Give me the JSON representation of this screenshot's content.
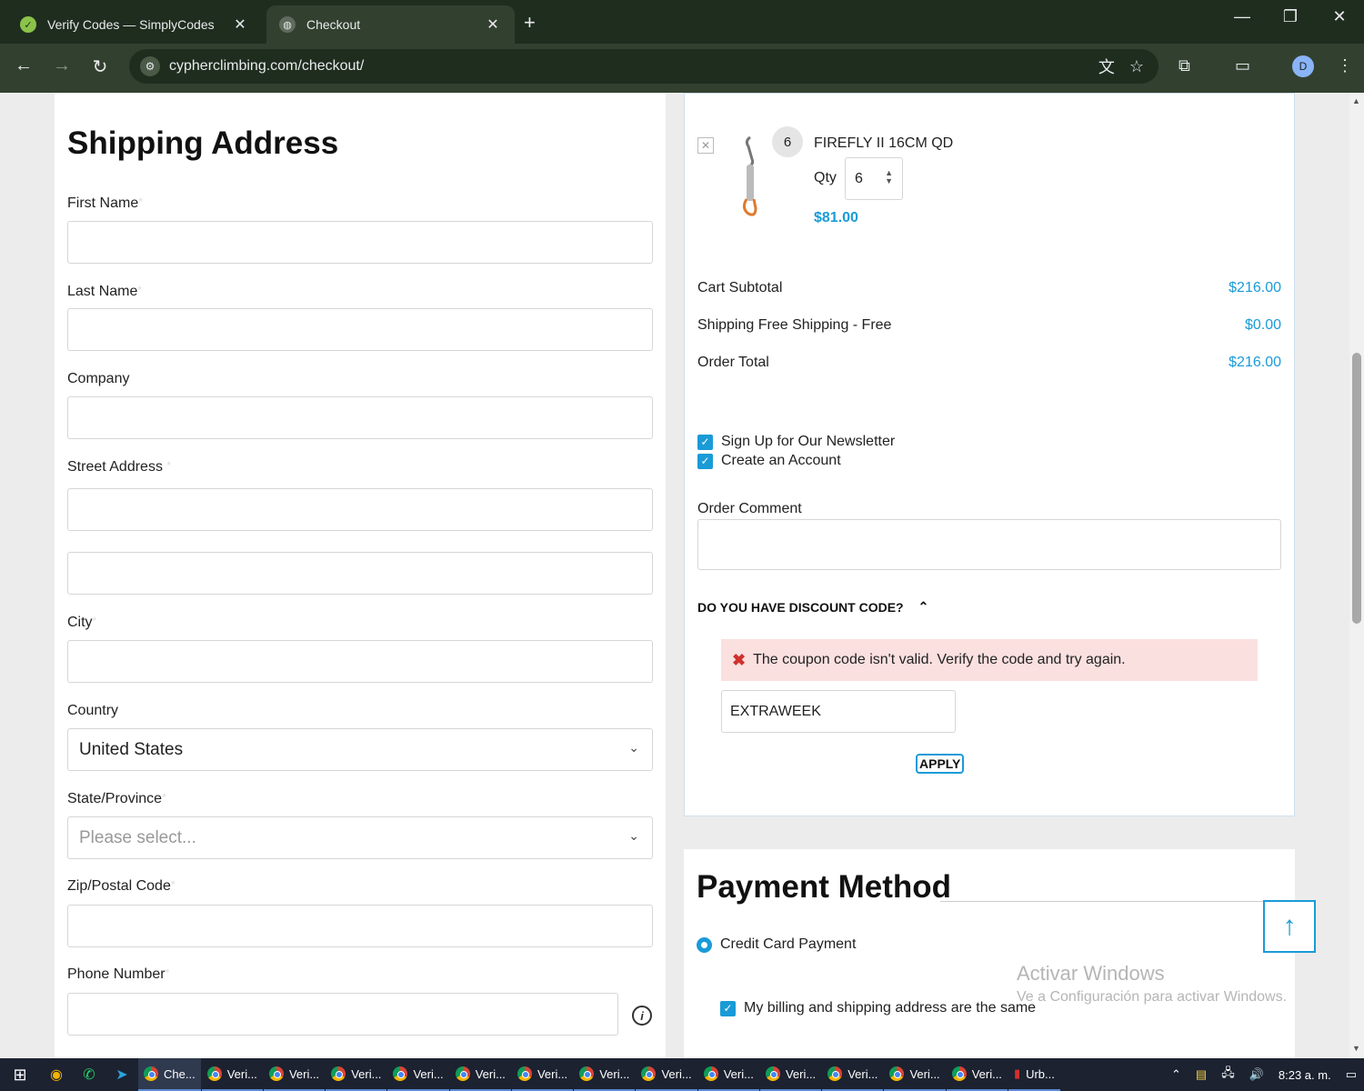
{
  "browser": {
    "tabs": [
      {
        "title": "Verify Codes — SimplyCodes",
        "active": false
      },
      {
        "title": "Checkout",
        "active": true
      }
    ],
    "url": "cypherclimbing.com/checkout/"
  },
  "shipping": {
    "title": "Shipping Address",
    "fields": {
      "first_name": "First Name",
      "last_name": "Last Name",
      "company": "Company",
      "street": "Street Address",
      "city": "City",
      "country": "Country",
      "state": "State/Province",
      "zip": "Zip/Postal Code",
      "phone": "Phone Number"
    },
    "required_mark": "*",
    "country_value": "United States",
    "state_placeholder": "Please select..."
  },
  "cart": {
    "item": {
      "name": "FIREFLY II 16CM QD",
      "qty_label": "Qty",
      "qty": "6",
      "badge": "6",
      "price": "$81.00"
    },
    "totals": [
      {
        "label": "Cart Subtotal",
        "value": "$216.00"
      },
      {
        "label": "Shipping Free Shipping - Free",
        "value": "$0.00"
      },
      {
        "label": "Order Total",
        "value": "$216.00"
      }
    ],
    "newsletter": "Sign Up for Our Newsletter",
    "create_account": "Create an Account",
    "order_comment": "Order Comment",
    "discount_title": "DO YOU HAVE DISCOUNT CODE?",
    "error": "The coupon code isn't valid. Verify the code and try again.",
    "coupon_value": "EXTRAWEEK",
    "apply": "APPLY"
  },
  "payment": {
    "title": "Payment Method",
    "option": "Credit Card Payment",
    "billing_same": "My billing and shipping address are the same"
  },
  "watermark": {
    "line1": "Activar Windows",
    "line2": "Ve a Configuración para activar Windows."
  },
  "taskbar": {
    "apps": [
      "Che...",
      "Veri...",
      "Veri...",
      "Veri...",
      "Veri...",
      "Veri...",
      "Veri...",
      "Veri...",
      "Veri...",
      "Veri...",
      "Veri...",
      "Veri...",
      "Veri...",
      "Veri...",
      "Urb..."
    ],
    "time": "8:23 a. m."
  },
  "colors": {
    "accent": "#1a9bd7",
    "error_bg": "#fbe0e0"
  }
}
